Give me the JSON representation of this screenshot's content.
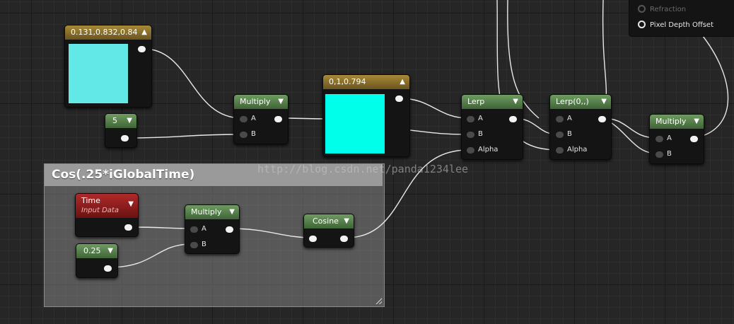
{
  "comment": {
    "title": "Cos(.25*iGlobalTime)"
  },
  "watermark": "http://blog.csdn.net/panda1234lee",
  "output_panel": {
    "items": [
      {
        "label": "Refraction",
        "enabled": false
      },
      {
        "label": "Pixel Depth Offset",
        "enabled": true
      }
    ]
  },
  "nodes": {
    "const3_a": {
      "title": "0.131,0.832,0.84",
      "color": "#63e8e8"
    },
    "const_5": {
      "title": "5"
    },
    "multiply_1": {
      "title": "Multiply",
      "pin_a": "A",
      "pin_b": "B"
    },
    "const3_b": {
      "title": "0,1,0.794",
      "color": "#00ffea"
    },
    "lerp_1": {
      "title": "Lerp",
      "pin_a": "A",
      "pin_b": "B",
      "pin_alpha": "Alpha"
    },
    "lerp_2": {
      "title": "Lerp(0,,)",
      "pin_a": "A",
      "pin_b": "B",
      "pin_alpha": "Alpha"
    },
    "multiply_3": {
      "title": "Multiply",
      "pin_a": "A",
      "pin_b": "B"
    },
    "time": {
      "title": "Time",
      "subtitle": "Input Data"
    },
    "const_025": {
      "title": "0.25"
    },
    "multiply_2": {
      "title": "Multiply",
      "pin_a": "A",
      "pin_b": "B"
    },
    "cosine": {
      "title": "Cosine"
    }
  },
  "colors": {
    "wire": "#e8e8e8",
    "header_green": "#5b8a4f",
    "header_gold": "#8f7430",
    "header_red": "#a42424"
  }
}
